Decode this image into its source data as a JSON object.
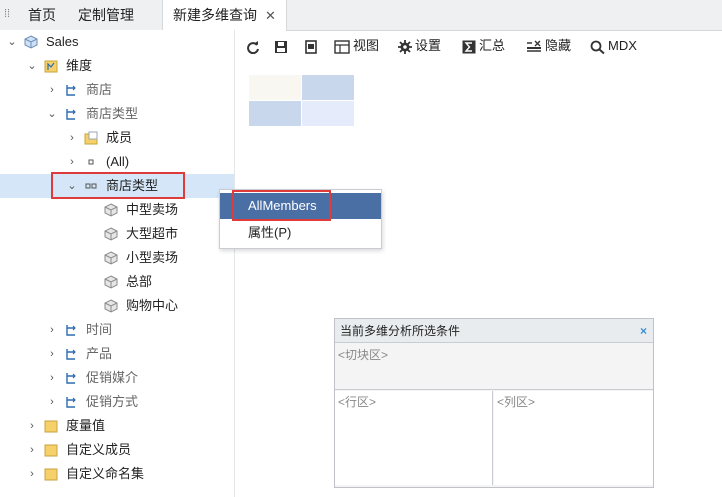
{
  "tabs": [
    {
      "label": "首页"
    },
    {
      "label": "定制管理"
    },
    {
      "label": "新建多维查询",
      "active": true,
      "close": "✕"
    }
  ],
  "tree": {
    "root": "Sales",
    "dimension": "维度",
    "store": "商店",
    "store_type_hier": "商店类型",
    "members": "成员",
    "all": "(All)",
    "store_type_level": "商店类型",
    "leaves": [
      "中型卖场",
      "大型超市",
      "小型卖场",
      "总部",
      "购物中心"
    ],
    "time": "时间",
    "product": "产品",
    "promo_media": "促销媒介",
    "promo_method": "促销方式",
    "measures": "度量值",
    "custom_members": "自定义成员",
    "custom_named_sets": "自定义命名集"
  },
  "toolbar": {
    "view": "视图",
    "settings": "设置",
    "summary": "汇总",
    "hide": "隐藏",
    "mdx": "MDX"
  },
  "context_menu": {
    "items": [
      "AllMembers",
      "属性(P)"
    ]
  },
  "conditions": {
    "title": "当前多维分析所选条件",
    "close": "×",
    "slice_zone": "<切块区>",
    "row_zone": "<行区>",
    "col_zone": "<列区>"
  },
  "colors": {
    "selected_row": "#d4e6f8",
    "menu_highlight": "#4a6fa5",
    "annotation_red": "#e03b3b",
    "icon_blue": "#2b6cb0",
    "folder_yellow": "#f5d06b"
  }
}
